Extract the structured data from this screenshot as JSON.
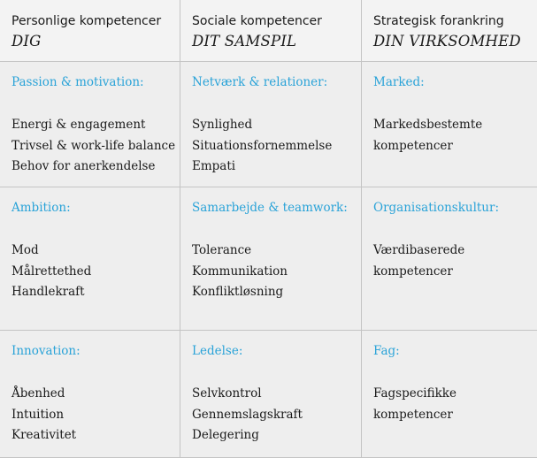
{
  "columns": [
    {
      "subtitle": "Personlige kompetencer",
      "title": "DIG"
    },
    {
      "subtitle": "Sociale kompetencer",
      "title": "DIT SAMSPIL"
    },
    {
      "subtitle": "Strategisk forankring",
      "title": "DIN VIRKSOMHED"
    }
  ],
  "rows": [
    [
      {
        "category": "Passion & motivation:",
        "items": [
          "Energi & engagement",
          "Trivsel & work-life balance",
          "Behov for anerkendelse"
        ]
      },
      {
        "category": "Netværk & relationer:",
        "items": [
          "Synlighed",
          "Situationsfornemmelse",
          "Empati"
        ]
      },
      {
        "category": "Marked:",
        "items": [
          "Markedsbestemte",
          "kompetencer"
        ]
      }
    ],
    [
      {
        "category": "Ambition:",
        "items": [
          "Mod",
          "Målrettethed",
          "Handlekraft"
        ]
      },
      {
        "category": "Samarbejde & teamwork:",
        "items": [
          "Tolerance",
          "Kommunikation",
          "Konfliktløsning"
        ]
      },
      {
        "category": "Organisationskultur:",
        "items": [
          "Værdibaserede",
          "kompetencer"
        ]
      }
    ],
    [
      {
        "category": "Innovation:",
        "items": [
          "Åbenhed",
          "Intuition",
          "Kreativitet"
        ]
      },
      {
        "category": "Ledelse:",
        "items": [
          "Selvkontrol",
          "Gennemslagskraft",
          "Delegering"
        ]
      },
      {
        "category": "Fag:",
        "items": [
          "Fagspecifikke",
          "kompetencer"
        ]
      }
    ]
  ],
  "colors": {
    "category_text": "#2aa3d8",
    "header_background": "#f3f3f3",
    "cell_background": "#eeeeee",
    "grid_line": "#c4c4c4"
  }
}
